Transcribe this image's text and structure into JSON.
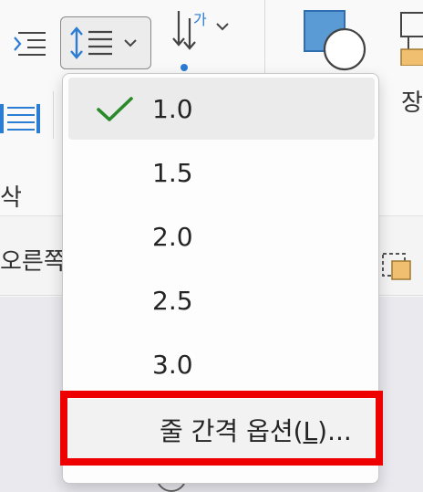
{
  "ribbon": {
    "left_fragment_bottom": "삭",
    "right_fragment_label": "장",
    "row_fragment_left": "오른쪽",
    "sort_icon_text": "가"
  },
  "line_spacing_menu": {
    "items": [
      {
        "label": "1.0",
        "selected": true
      },
      {
        "label": "1.5",
        "selected": false
      },
      {
        "label": "2.0",
        "selected": false
      },
      {
        "label": "2.5",
        "selected": false
      },
      {
        "label": "3.0",
        "selected": false
      }
    ],
    "options": {
      "label_prefix": "줄 간격 옵션(",
      "accelerator": "L",
      "label_suffix": ")..."
    }
  },
  "colors": {
    "check": "#2a8a2a",
    "accent_blue": "#2b7cd3",
    "highlight_red": "#ee0000",
    "shape_fill": "#5b9bd5"
  }
}
